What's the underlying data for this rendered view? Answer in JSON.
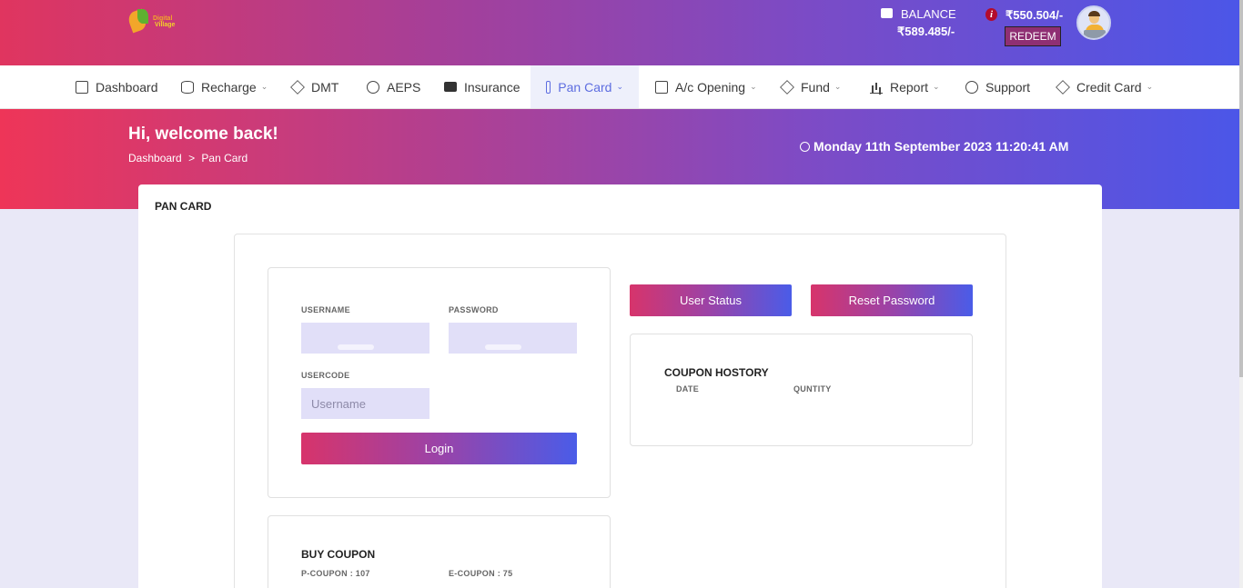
{
  "header": {
    "logo_line1": "Digital",
    "logo_line2": "Village",
    "balance_label": "BALANCE",
    "balance_amount": "₹589.485/-",
    "points_amount": "₹550.504/-",
    "redeem_label": "REDEEM",
    "colors": {
      "gradient_start": "#e0355f",
      "gradient_end": "#4b56e8"
    }
  },
  "nav": {
    "items": [
      {
        "label": "Dashboard",
        "icon": "monitor-icon",
        "dropdown": false
      },
      {
        "label": "Recharge",
        "icon": "database-icon",
        "dropdown": true
      },
      {
        "label": "DMT",
        "icon": "layers-icon",
        "dropdown": false
      },
      {
        "label": "AEPS",
        "icon": "aperture-icon",
        "dropdown": false
      },
      {
        "label": "Insurance",
        "icon": "id-card-icon",
        "dropdown": false
      },
      {
        "label": "Pan Card",
        "icon": "book-icon",
        "dropdown": true,
        "active": true
      },
      {
        "label": "A/c Opening",
        "icon": "book-icon",
        "dropdown": true
      },
      {
        "label": "Fund",
        "icon": "codepen-icon",
        "dropdown": true
      },
      {
        "label": "Report",
        "icon": "bar-chart-icon",
        "dropdown": true
      },
      {
        "label": "Support",
        "icon": "compass-icon",
        "dropdown": false
      },
      {
        "label": "Credit Card",
        "icon": "box-icon",
        "dropdown": true
      }
    ]
  },
  "hero": {
    "welcome": "Hi, welcome back!",
    "breadcrumb_home": "Dashboard",
    "breadcrumb_sep": ">",
    "breadcrumb_current": "Pan Card",
    "datetime": "Monday 11th September 2023 11:20:41 AM"
  },
  "main": {
    "title": "PAN CARD",
    "login": {
      "username_label": "USERNAME",
      "password_label": "PASSWORD",
      "usercode_label": "USERCODE",
      "usercode_placeholder": "Username",
      "login_button": "Login"
    },
    "actions": {
      "user_status": "User Status",
      "reset_password": "Reset Password"
    },
    "history": {
      "title": "COUPON HOSTORY",
      "col_date": "DATE",
      "col_quantity": "QUNTITY"
    },
    "buy_coupon": {
      "title": "BUY COUPON",
      "p_coupon": "P-COUPON : 107",
      "e_coupon": "E-COUPON : 75"
    }
  }
}
